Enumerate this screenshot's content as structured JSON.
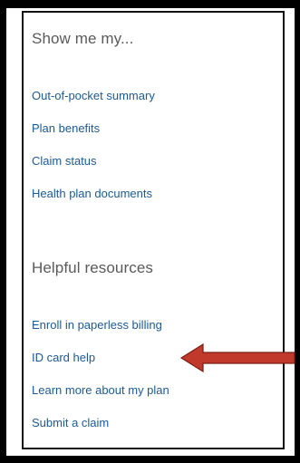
{
  "panel": {
    "show_me": {
      "heading": "Show me my...",
      "links": [
        "Out-of-pocket summary",
        "Plan benefits",
        "Claim status",
        "Health plan documents"
      ]
    },
    "resources": {
      "heading": "Helpful resources",
      "links": [
        "Enroll in paperless billing",
        "ID card help",
        "Learn more about my plan",
        "Submit a claim"
      ]
    }
  },
  "annotation": {
    "arrow_color": "#c0392b",
    "arrow_icon": "left-arrow-icon"
  },
  "colors": {
    "link": "#1d5a93",
    "heading": "#5a5a5a",
    "frame": "#000000"
  }
}
